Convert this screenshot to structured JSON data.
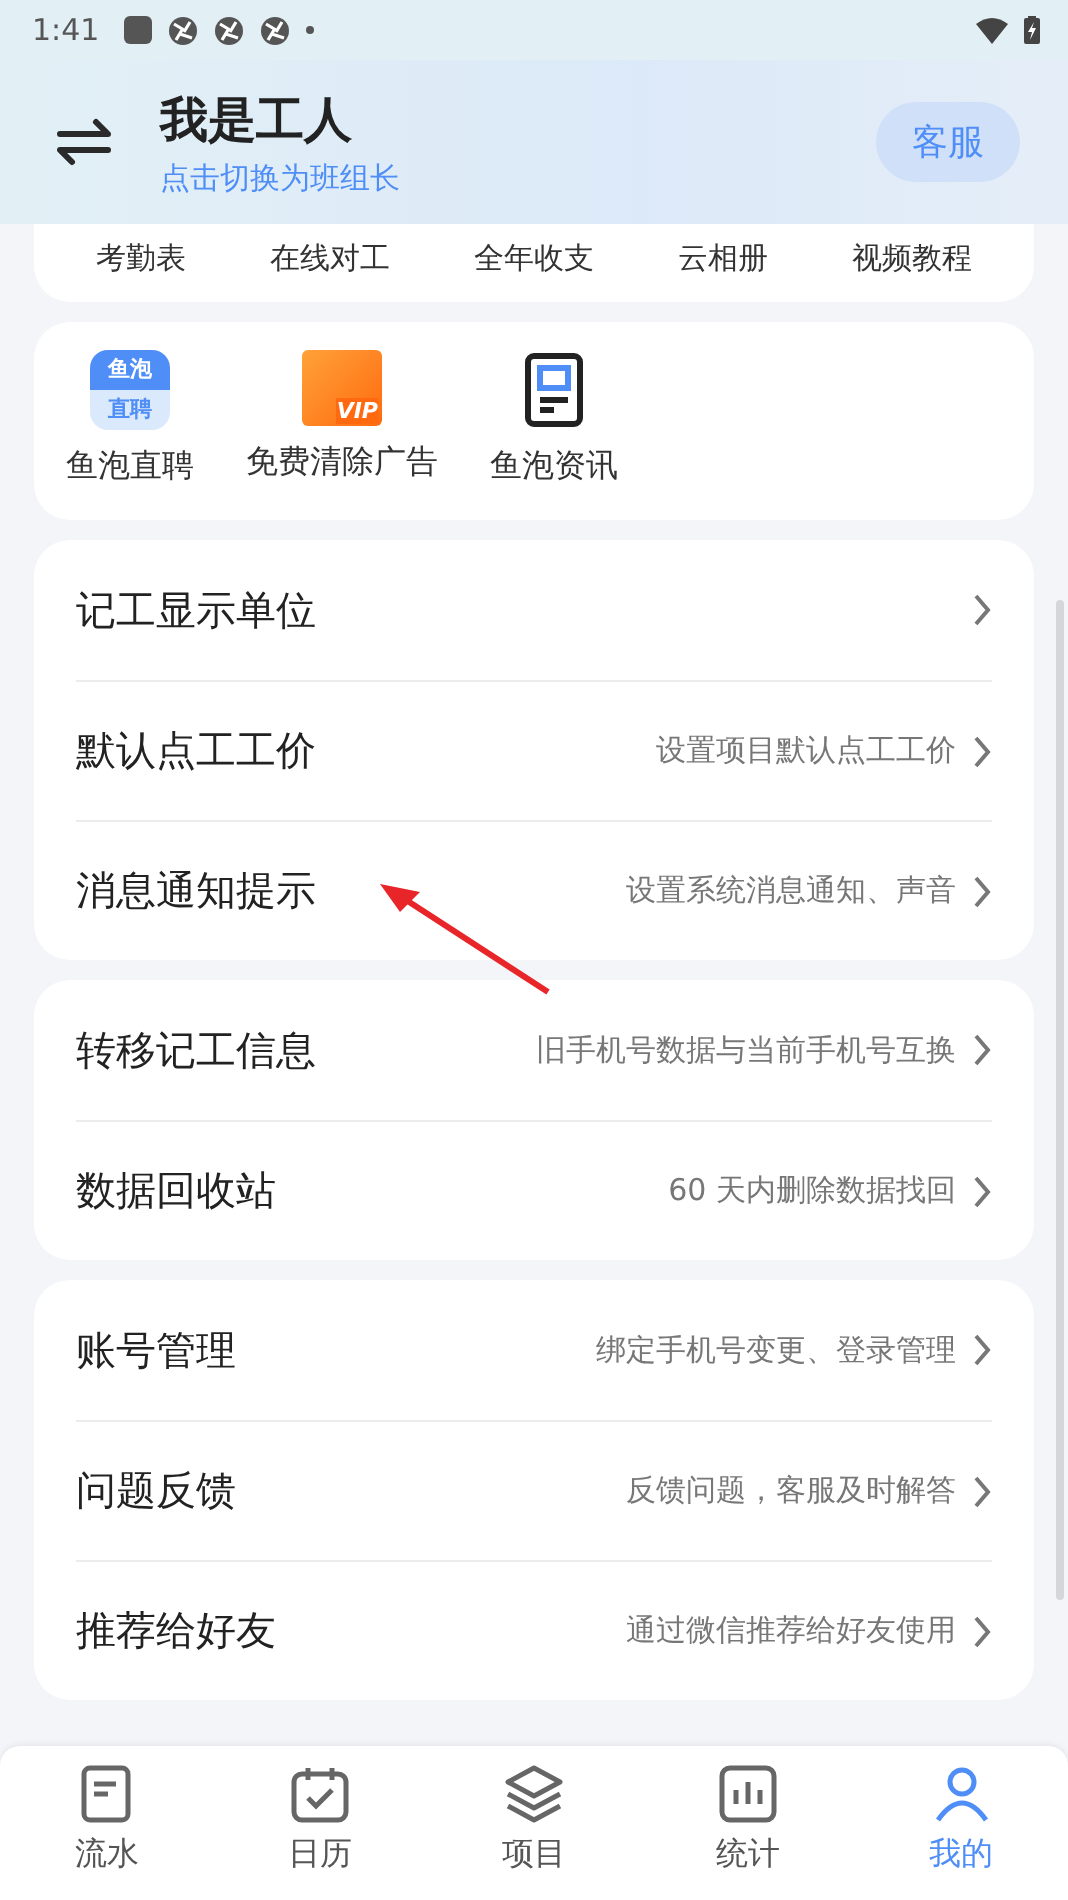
{
  "status_bar": {
    "time": "1:41"
  },
  "header": {
    "title": "我是工人",
    "subtitle": "点击切换为班组长",
    "service_button": "客服"
  },
  "tools": [
    "考勤表",
    "在线对工",
    "全年收支",
    "云相册",
    "视频教程"
  ],
  "services": [
    {
      "kind": "recruit",
      "label": "鱼泡直聘",
      "icon_text": [
        "鱼泡",
        "直聘"
      ]
    },
    {
      "kind": "vip",
      "label": "免费清除广告",
      "icon_text": [
        "VIP"
      ]
    },
    {
      "kind": "news",
      "label": "鱼泡资讯"
    }
  ],
  "setting_groups": [
    [
      {
        "label": "记工显示单位"
      },
      {
        "label": "默认点工工价",
        "hint": "设置项目默认点工工价"
      },
      {
        "label": "消息通知提示",
        "hint": "设置系统消息通知、声音"
      }
    ],
    [
      {
        "label": "转移记工信息",
        "hint": "旧手机号数据与当前手机号互换"
      },
      {
        "label": "数据回收站",
        "hint": "60 天内删除数据找回"
      }
    ],
    [
      {
        "label": "账号管理",
        "hint": "绑定手机号变更、登录管理"
      },
      {
        "label": "问题反馈",
        "hint": "反馈问题，客服及时解答"
      },
      {
        "label": "推荐给好友",
        "hint": "通过微信推荐给好友使用"
      }
    ]
  ],
  "tab_bar": [
    {
      "kind": "flow",
      "label": "流水",
      "selected": false
    },
    {
      "kind": "calendar",
      "label": "日历",
      "selected": false
    },
    {
      "kind": "project",
      "label": "项目",
      "selected": false
    },
    {
      "kind": "stats",
      "label": "统计",
      "selected": false
    },
    {
      "kind": "mine",
      "label": "我的",
      "selected": true
    }
  ]
}
